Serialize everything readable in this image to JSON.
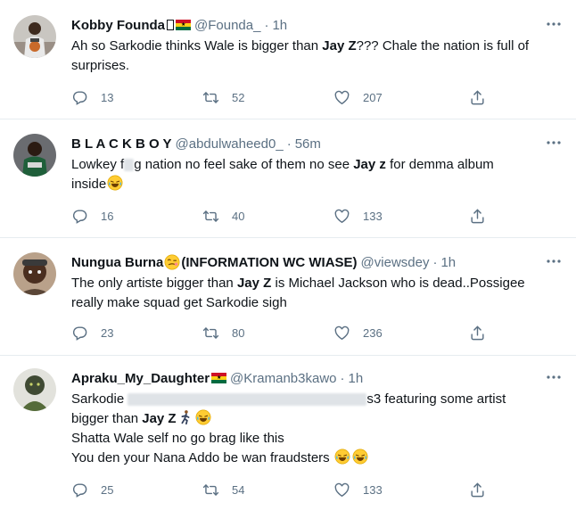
{
  "tweets": [
    {
      "name": "Kobby Founda",
      "handle": "@Founda_",
      "separator": "·",
      "time": "1h",
      "line1_pre": "Ah so Sarkodie thinks Wale is bigger than ",
      "line1_bold": "Jay Z",
      "line1_post": "??? Chale the nation is full of",
      "line2": "surprises.",
      "replies": "13",
      "retweets": "52",
      "likes": "207"
    },
    {
      "name": "B L A C K B O Y",
      "handle": "@abdulwaheed0_",
      "separator": "·",
      "time": "56m",
      "line1_pre": "Lowkey f",
      "line1_mid": "g nation no feel sake of them no see ",
      "line1_bold": "Jay z",
      "line1_post": " for demma album",
      "line2": "inside",
      "replies": "16",
      "retweets": "40",
      "likes": "133"
    },
    {
      "name": "Nungua Burna",
      "name_suffix": "(INFORMATION WC WIASE)",
      "handle": "@viewsdey",
      "separator": "·",
      "time": "1h",
      "line1_pre": "The only artiste bigger than ",
      "line1_bold": "Jay Z",
      "line1_post": " is Michael Jackson who is dead..Possigee",
      "line2": "really make squad get Sarkodie sigh",
      "replies": "23",
      "retweets": "80",
      "likes": "236"
    },
    {
      "name": "Apraku_My_Daughter",
      "handle": "@Kramanb3kawo",
      "separator": "·",
      "time": "1h",
      "line1_pre": "Sarkodie ",
      "line1_post": "s3 featuring some artist",
      "line2_pre": "bigger than ",
      "line2_bold": "Jay Z",
      "line3": "Shatta Wale self no go brag like this",
      "line4": "You den your Nana Addo be wan fraudsters ",
      "replies": "25",
      "retweets": "54",
      "likes": "133"
    }
  ],
  "icons": [
    "more-icon",
    "reply-icon",
    "retweet-icon",
    "like-icon",
    "share-icon",
    "ghana-flag-icon",
    "laughing-emoji-icon",
    "running-emoji-icon",
    "woozy-emoji-icon"
  ],
  "colors": {
    "text": "#0f1419",
    "muted": "#5b7083",
    "divider": "#e6ecf0"
  }
}
